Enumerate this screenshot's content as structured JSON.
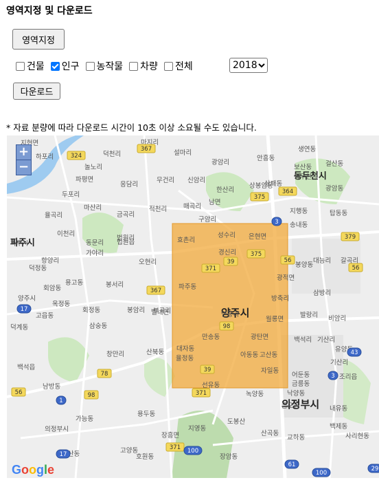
{
  "page": {
    "title": "영역지정 및 다운로드"
  },
  "toolbar": {
    "area_button": "영역지정",
    "download_button": "다운로드",
    "year": "2018",
    "options": [
      {
        "label": "건물",
        "checked": false
      },
      {
        "label": "인구",
        "checked": true
      },
      {
        "label": "농작물",
        "checked": false
      },
      {
        "label": "차량",
        "checked": false
      },
      {
        "label": "전체",
        "checked": false
      }
    ]
  },
  "note": "* 자료 분량에 따라 다운로드 시간이 10초 이상 소요될 수도 있습니다.",
  "map": {
    "zoom_in": "+",
    "zoom_out": "−",
    "logo": "Google",
    "selection_color": "#f2a93b",
    "cities": [
      "파주시",
      "양주시",
      "의정부시",
      "동두천시"
    ],
    "places": [
      "지현면",
      "하포리",
      "덕천리",
      "마지리",
      "설마리",
      "광암리",
      "안흥동",
      "생연동",
      "동두천시",
      "걸산동",
      "놀노리",
      "파평면",
      "보산동",
      "응담리",
      "무건리",
      "상봉암동",
      "한산리",
      "상패동",
      "광암동",
      "두포리",
      "마산리",
      "금곡리",
      "적천리",
      "남면",
      "신암리",
      "매곡리",
      "구암리",
      "지행동",
      "탑동동",
      "율곡리",
      "이천리",
      "동문리",
      "법원읍",
      "효촌리",
      "성수리",
      "은현면",
      "송내동",
      "파주시",
      "향양리",
      "가야리",
      "법원리",
      "오현리",
      "경신리",
      "봉양동",
      "대능리",
      "갈곡리",
      "덕정동",
      "회암동",
      "용고동",
      "봉서리",
      "파주동",
      "연풍리",
      "삼방리",
      "광적면",
      "양주시",
      "옥정동",
      "회정동",
      "봉암리",
      "부곡리",
      "방축리",
      "발랑리",
      "비암리",
      "덕계동",
      "고읍동",
      "삼숭동",
      "월롱면",
      "백석리",
      "창만리",
      "산북동",
      "만송동",
      "광탄면",
      "기산리",
      "백석읍",
      "유양동",
      "율정동",
      "아동동",
      "고산동",
      "기산리",
      "어둔동",
      "남방동",
      "자일동",
      "금릉동",
      "조리읍",
      "녹양동",
      "금오동",
      "낙양동",
      "가능동",
      "의정부시",
      "용두동",
      "내유동",
      "지영동",
      "백제동",
      "고산동",
      "장흥면",
      "산곡동",
      "교하동",
      "사리현동",
      "고양동",
      "호원동",
      "장암동",
      "벨내면",
      "대자동",
      "선유동",
      "도봉산"
    ],
    "routes": [
      "324",
      "367",
      "364",
      "375",
      "3",
      "379",
      "56",
      "371",
      "39",
      "375",
      "56",
      "367",
      "17",
      "98",
      "78",
      "1",
      "98",
      "43",
      "3",
      "56",
      "371",
      "39",
      "17",
      "371",
      "100",
      "61",
      "100",
      "29"
    ]
  }
}
